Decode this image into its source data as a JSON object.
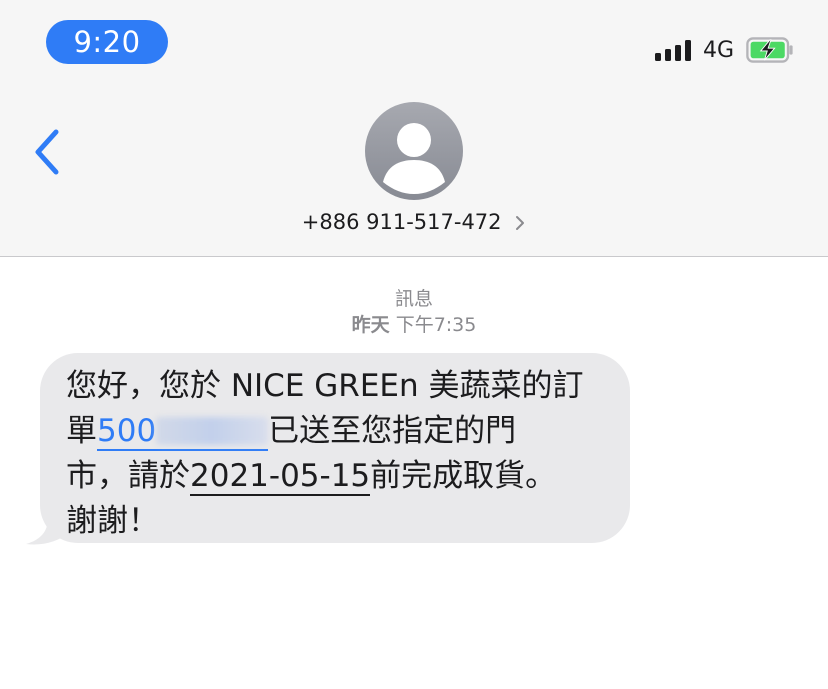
{
  "status_bar": {
    "time": "9:20",
    "network": "4G",
    "signal_bars": 4,
    "battery_charging": true,
    "accent_color": "#2f7cf6"
  },
  "header": {
    "back_icon": "chevron-left-icon",
    "avatar_icon": "person-silhouette-icon",
    "contact_number": "+886 911-517-472",
    "contact_chevron_icon": "chevron-right-icon"
  },
  "conversation": {
    "service_label": "訊息",
    "day_label": "昨天",
    "time_label": "下午7:35",
    "message": {
      "line1": "您好，您於 NICE GREEn 美蔬菜的訂",
      "line2_prefix": "單",
      "order_link": "500",
      "line2_suffix": "已送至您指定的門",
      "line3_prefix": "市，請於",
      "date_link": "2021-05-15",
      "line3_suffix": "前完成取貨。",
      "line4": "謝謝！"
    }
  }
}
